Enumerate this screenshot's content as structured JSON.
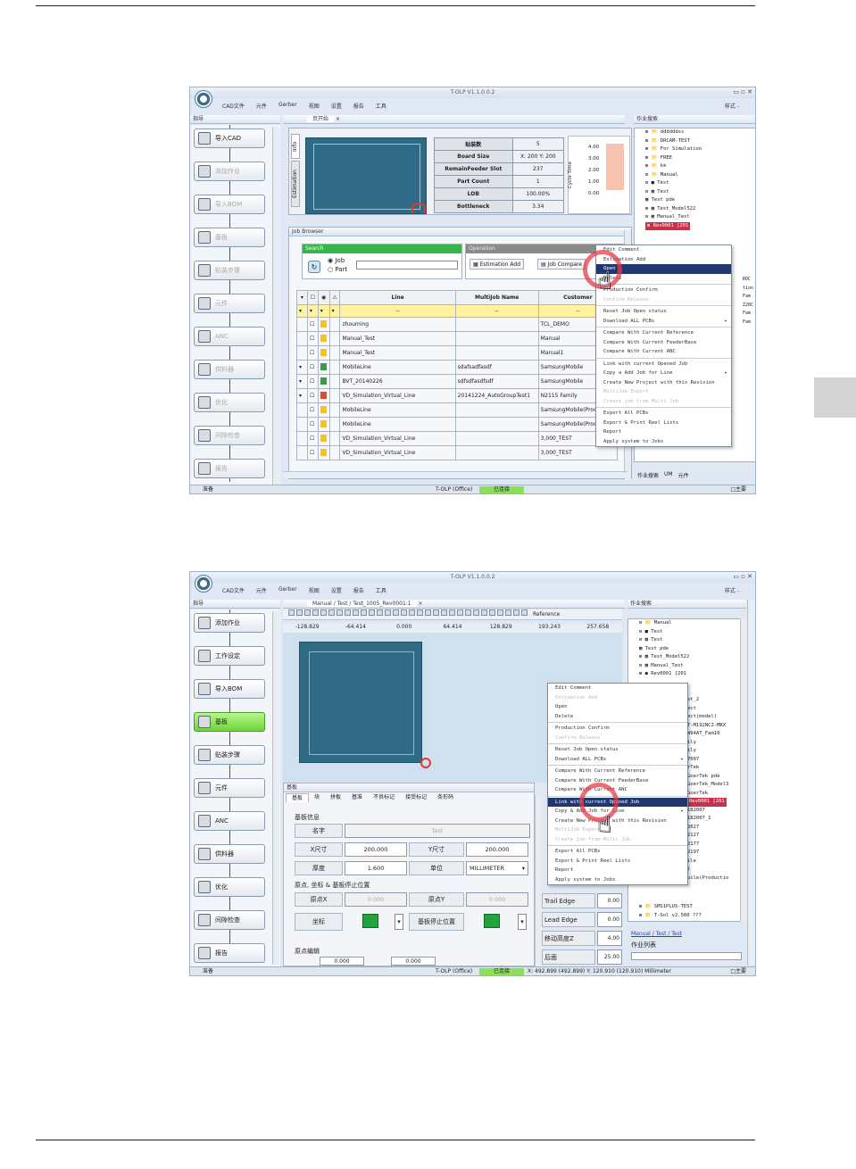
{
  "page": {
    "side_tab_color": "#d4d4d4"
  },
  "common": {
    "app_title": "T-OLP V1.1.0.0.2",
    "menu": [
      "CAD文件",
      "元件",
      "Gerber",
      "视图",
      "设置",
      "报告",
      "工具"
    ],
    "style_label": "样式 -",
    "status_ready": "准备",
    "status_mode": "T-OLP (Office)",
    "status_connected": "已连接",
    "status_right": "□主要"
  },
  "shot1": {
    "left_header": "指导",
    "doc_tab": "页开始",
    "right_header": "作业搜索",
    "nav_items": [
      {
        "label": "导入CAD",
        "faded": false
      },
      {
        "label": "添加作业",
        "faded": true
      },
      {
        "label": "导入BOM",
        "faded": true
      },
      {
        "label": "基板",
        "faded": true
      },
      {
        "label": "贴装步骤",
        "faded": true
      },
      {
        "label": "元件",
        "faded": true
      },
      {
        "label": "ANC",
        "faded": true
      },
      {
        "label": "供料器",
        "faded": true
      },
      {
        "label": "优化",
        "faded": true
      },
      {
        "label": "间隙检查",
        "faded": true
      },
      {
        "label": "报告",
        "faded": true
      }
    ],
    "vertical_tabs": [
      "Info",
      "Estimation"
    ],
    "info_table": [
      {
        "label": "贴装数",
        "value": "5"
      },
      {
        "label": "Board Size",
        "value": "X: 200  Y: 200"
      },
      {
        "label": "RemainFeeder Slot",
        "value": "237"
      },
      {
        "label": "Part Count",
        "value": "1"
      },
      {
        "label": "LOB",
        "value": "100.00%"
      },
      {
        "label": "Bottleneck",
        "value": "3.34"
      }
    ],
    "cycle_label": "Cycle Time",
    "cycle_ticks": [
      "4.00",
      "3.00",
      "2.00",
      "1.00",
      "0.00"
    ],
    "job_browser_title": "Job Browser",
    "search_title": "Search",
    "search_options": [
      "Job",
      "Part"
    ],
    "operation_title": "Operation",
    "operation_buttons": [
      "Estimation Add",
      "Job Compare"
    ],
    "grid_headers": [
      "Line",
      "MultiJob Name",
      "Customer"
    ],
    "grid_filter": "--",
    "grid_rows": [
      {
        "line": "zhouming",
        "multijob": "",
        "customer": "TCL_DEMO"
      },
      {
        "line": "Manual_Test",
        "multijob": "",
        "customer": "Manual"
      },
      {
        "line": "Manual_Test",
        "multijob": "",
        "customer": "Manual1"
      },
      {
        "line": "MobileLine",
        "multijob": "sdafsadfasdf",
        "customer": "SamsungMobile"
      },
      {
        "line": "BVT_20140226",
        "multijob": "sdfsdfasdfsdf",
        "customer": "SamsungMobile"
      },
      {
        "line": "VD_Simulation_Virtual_Line",
        "multijob": "20141224_AutoGroupTest1",
        "customer": "N2115 Family"
      },
      {
        "line": "MobileLine",
        "multijob": "",
        "customer": "SamsungMobile(Prod"
      },
      {
        "line": "MobileLine",
        "multijob": "",
        "customer": "SamsungMobile(Prod"
      },
      {
        "line": "VD_Simulation_Virtual_Line",
        "multijob": "",
        "customer": "3,000_TEST"
      },
      {
        "line": "VD_Simulation_Virtual_Line",
        "multijob": "",
        "customer": "3,000_TEST"
      }
    ],
    "tree_items": [
      "⊞ 📁 ddddddss",
      "⊞ 📁 DRCAM-TEST",
      "⊞ 📁 For Simulation",
      "⊞ 📁 FREE",
      "⊞ 📁 kk",
      "⊟ 📁 Manual",
      "  ⊟ ■ Test",
      "    ⊟ ▦ Test",
      "       ▦ Test pde",
      "     ⊞ ▦ Test_Model522",
      "     ⊟ ▦ Manual_Test"
    ],
    "tree_highlight": "Rev0001 [201",
    "tree_right_fragments": [
      "ROC",
      "tion",
      "Fam",
      "Z20C",
      "Fam",
      "Fam"
    ],
    "context_menu": [
      {
        "label": "Edit Comment",
        "state": "normal"
      },
      {
        "label": "Estimation Add",
        "state": "normal"
      },
      {
        "label": "Open",
        "state": "selected"
      },
      {
        "label": "Delete",
        "state": "normal"
      },
      {
        "label": "sep"
      },
      {
        "label": "Production Confirm",
        "state": "normal"
      },
      {
        "label": "Confirm Release",
        "state": "dim"
      },
      {
        "label": "sep"
      },
      {
        "label": "Reset Job Open status",
        "state": "normal"
      },
      {
        "label": "Download ALL PCBs",
        "state": "arrow"
      },
      {
        "label": "sep"
      },
      {
        "label": "Compare With Current Reference",
        "state": "normal"
      },
      {
        "label": "Compare With Current FeederBase",
        "state": "normal"
      },
      {
        "label": "Compare With Current ANC",
        "state": "normal"
      },
      {
        "label": "sep"
      },
      {
        "label": "Link with current Opened Job",
        "state": "normal"
      },
      {
        "label": "Copy a Add Job for Line",
        "state": "arrow"
      },
      {
        "label": "Create New Project with this Revision",
        "state": "normal"
      },
      {
        "label": "MultiJob Export",
        "state": "dim"
      },
      {
        "label": "Create job from Multi Job",
        "state": "dim"
      },
      {
        "label": "sep"
      },
      {
        "label": "Export All PCBs",
        "state": "normal"
      },
      {
        "label": "Export & Print Reel Lists",
        "state": "normal"
      },
      {
        "label": "Report",
        "state": "normal"
      },
      {
        "label": "Apply system to Jobs",
        "state": "normal"
      }
    ],
    "bottom_tabs": [
      "作业搜索",
      "UM",
      "元件"
    ]
  },
  "shot2": {
    "left_header": "指导",
    "doc_tab": "Manual / Test / Test_1005_Rev0001:1",
    "right_header": "作业搜索",
    "toolbar_reference": "Reference",
    "nav_items": [
      {
        "label": "添加作业",
        "active": false
      },
      {
        "label": "工作设定",
        "active": false
      },
      {
        "label": "导入BOM",
        "active": false
      },
      {
        "label": "基板",
        "active": true
      },
      {
        "label": "贴装步骤",
        "active": false
      },
      {
        "label": "元件",
        "active": false
      },
      {
        "label": "ANC",
        "active": false
      },
      {
        "label": "供料器",
        "active": false
      },
      {
        "label": "优化",
        "active": false
      },
      {
        "label": "间隙检查",
        "active": false
      },
      {
        "label": "报告",
        "active": false
      }
    ],
    "ruler": [
      "-128.829",
      "-64.414",
      "0.000",
      "64.414",
      "128.829",
      "193.243",
      "257.658"
    ],
    "board_panel_title": "基板",
    "board_tabs": [
      "基板",
      "块",
      "拼板",
      "基准",
      "不良标记",
      "接受标记",
      "条形码"
    ],
    "board_info_title": "基板信息",
    "name_label": "名字",
    "name_value": "Test",
    "x_label": "X尺寸",
    "x_value": "200.000",
    "y_label": "Y尺寸",
    "y_value": "200.000",
    "thick_label": "厚度",
    "thick_value": "1.600",
    "unit_label": "单位",
    "unit_value": "MILLIMETER",
    "origin_title": "原点, 坐标 & 基板停止位置",
    "ox_label": "原点X",
    "ox_value": "0.000",
    "oy_label": "原点Y",
    "oy_value": "0.000",
    "coord_label": "坐标",
    "stop_label": "基板停止位置",
    "origin_edit": "原点编辑",
    "origin_edit_values": [
      "0.000",
      "0.000"
    ],
    "side_labels": [
      "Trail Edge",
      "Lead Edge",
      "移动高度Z",
      "后面"
    ],
    "side_values": [
      "0.00",
      "0.00",
      "4.00",
      "25.00"
    ],
    "tree_items": [
      "⊟ 📁 Manual",
      "  ⊟ ■ Test",
      "    ⊟ ▦ Test",
      "       ▦ Test pde",
      "     ⊞ ▦ Test_Model522",
      "     ⊟ ▦ Manual_Test"
    ],
    "tree_rev": "Rev0001 [201",
    "tree_fragments": [
      "st_2",
      "ect",
      "ect(model)",
      "T-M192NCZ-MRX",
      "W94AT_Fam10",
      "ily",
      "ily",
      "7007",
      "rTek",
      "GoerTek pde",
      "GoerTek_Model3",
      "GoerTek"
    ],
    "tree_highlight": "Rev0001 [201",
    "tree_fragments2": [
      "182007",
      "182007_1",
      "2027",
      "2127",
      "2177",
      "2197",
      "ile",
      ")",
      "bile(Productio"
    ],
    "tree_bottom": [
      "⊞ 📁 SMS1PLUS-TEST",
      "⊞ 📁 T-Sol v2.500 ???"
    ],
    "breadcrumb": "Manual / Test / Test",
    "list_title": "作业列表",
    "coords_text": "X: 492.899 (492.899)  Y: 120.910 (120.910)   Millimeter",
    "context_menu": [
      {
        "label": "Edit Comment",
        "state": "normal"
      },
      {
        "label": "Estimation Add",
        "state": "dim"
      },
      {
        "label": "Open",
        "state": "normal"
      },
      {
        "label": "Delete",
        "state": "normal"
      },
      {
        "label": "sep"
      },
      {
        "label": "Production Confirm",
        "state": "normal"
      },
      {
        "label": "Confirm Release",
        "state": "dim"
      },
      {
        "label": "sep"
      },
      {
        "label": "Reset Job Open status",
        "state": "normal"
      },
      {
        "label": "Download ALL PCBs",
        "state": "arrow"
      },
      {
        "label": "sep"
      },
      {
        "label": "Compare With Current Reference",
        "state": "normal"
      },
      {
        "label": "Compare With Current FeederBase",
        "state": "normal"
      },
      {
        "label": "Compare With Current ANC",
        "state": "normal"
      },
      {
        "label": "sep"
      },
      {
        "label": "Link with current Opened Job",
        "state": "selected"
      },
      {
        "label": "Copy & Add Job for Line",
        "state": "arrow"
      },
      {
        "label": "Create New Project with this Revision",
        "state": "normal"
      },
      {
        "label": "MultiJob Export",
        "state": "dim"
      },
      {
        "label": "Create job from Multi Job",
        "state": "dim"
      },
      {
        "label": "sep"
      },
      {
        "label": "Export All PCBs",
        "state": "normal"
      },
      {
        "label": "Export & Print Reel Lists",
        "state": "normal"
      },
      {
        "label": "Report",
        "state": "normal"
      },
      {
        "label": "Apply system to Jobs",
        "state": "normal"
      }
    ]
  }
}
